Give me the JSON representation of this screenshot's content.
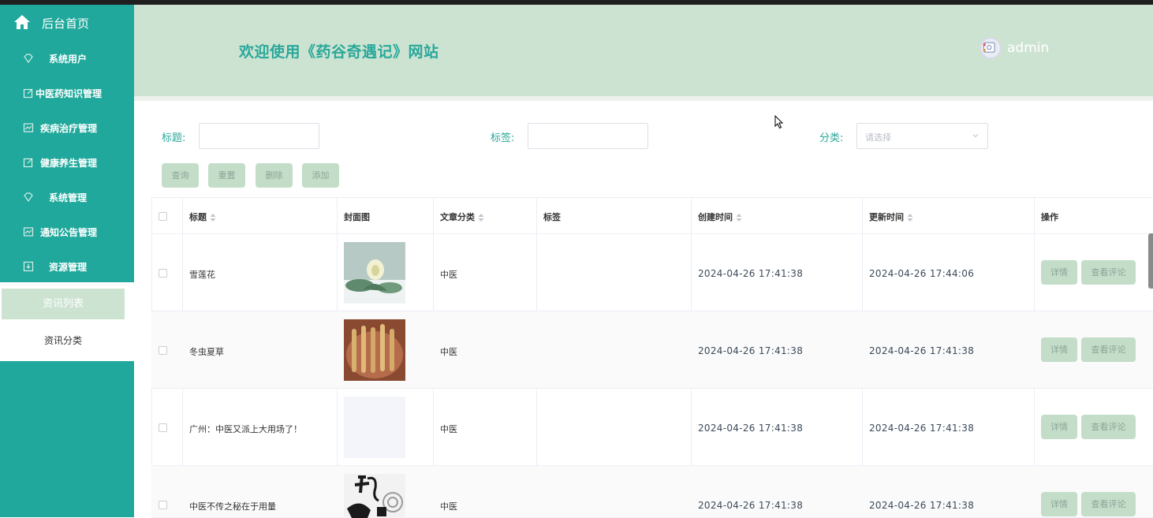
{
  "sidebar": {
    "home_label": "后台首页",
    "items": [
      {
        "label": "系统用户",
        "icon": "diamond-icon"
      },
      {
        "label": "中医药知识管理",
        "icon": "edit-icon"
      },
      {
        "label": "疾病治疗管理",
        "icon": "chart-icon"
      },
      {
        "label": "健康养生管理",
        "icon": "edit-icon"
      },
      {
        "label": "系统管理",
        "icon": "diamond-icon"
      },
      {
        "label": "通知公告管理",
        "icon": "chart-icon"
      },
      {
        "label": "资源管理",
        "icon": "download-icon"
      }
    ],
    "submenu": {
      "active": "资讯列表",
      "other": "资讯分类"
    }
  },
  "header": {
    "title": "欢迎使用《药谷奇遇记》网站",
    "username": "admin"
  },
  "filters": {
    "title_label": "标题:",
    "tag_label": "标签:",
    "category_label": "分类:",
    "category_placeholder": "请选择"
  },
  "actions": {
    "search": "查询",
    "reset": "重置",
    "delete": "删除",
    "add": "添加"
  },
  "table": {
    "headers": {
      "title": "标题",
      "cover": "封面图",
      "category": "文章分类",
      "tags": "标签",
      "created": "创建时间",
      "updated": "更新时间",
      "ops": "操作"
    },
    "rows": [
      {
        "title": "雪莲花",
        "category": "中医",
        "tags": "",
        "created": "2024-04-26 17:41:38",
        "updated": "2024-04-26 17:44:06"
      },
      {
        "title": "冬虫夏草",
        "category": "中医",
        "tags": "",
        "created": "2024-04-26 17:41:38",
        "updated": "2024-04-26 17:41:38"
      },
      {
        "title": "广州：中医又派上大用场了！",
        "category": "中医",
        "tags": "",
        "created": "2024-04-26 17:41:38",
        "updated": "2024-04-26 17:41:38"
      },
      {
        "title": "中医不传之秘在于用量",
        "category": "中医",
        "tags": "",
        "created": "2024-04-26 17:41:38",
        "updated": "2024-04-26 17:41:38"
      }
    ],
    "row_actions": {
      "detail": "详情",
      "comments": "查看评论"
    }
  },
  "colors": {
    "sidebar": "#1fa89b",
    "header": "#cde3d2",
    "accent": "#29a89a",
    "button": "#c3ddc9"
  }
}
